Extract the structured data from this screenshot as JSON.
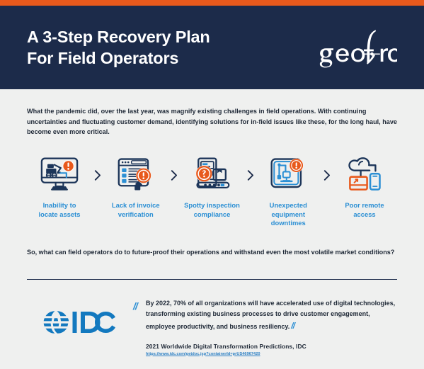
{
  "colors": {
    "accent_orange": "#e8591c",
    "navy": "#1c2b4a",
    "link_blue": "#2b8fd4",
    "page_background": "#eff0ef"
  },
  "header": {
    "title_line_1": "A 3-Step Recovery Plan",
    "title_line_2": "For Field Operators",
    "logo_name": "geoforce",
    "logo_text_part_1": "geo",
    "logo_text_part_2": "f",
    "logo_text_part_3": "orce"
  },
  "intro": {
    "paragraph": "What the pandemic did, over the last year, was magnify existing challenges in field operations. With continuing uncertainties and fluctuating customer demand, identifying solutions for in-field issues like these, for the long haul, have become even more critical."
  },
  "challenges": {
    "separator_icon": "chevron-right-icon",
    "items": [
      {
        "icon": "monitor-excavator-alert-icon",
        "label": "Inability to\nlocate assets"
      },
      {
        "icon": "invoice-magnifier-alert-icon",
        "label": "Lack of invoice\nverification"
      },
      {
        "icon": "inspection-question-icon",
        "label": "Spotty inspection\ncompliance"
      },
      {
        "icon": "equipment-downtime-alert-icon",
        "label": "Unexpected equipment\ndowntimes"
      },
      {
        "icon": "cloud-remote-access-icon",
        "label": "Poor remote\naccess"
      }
    ]
  },
  "midsection": {
    "paragraph": "So, what can field operators do to future-proof their operations and withstand even the most volatile market conditions?"
  },
  "quote": {
    "logo_name": "idc-logo",
    "logo_text": "IDC",
    "open_quote_mark": "//",
    "close_quote_mark": "//",
    "text": "By 2022, 70% of all organizations will have accelerated use of digital technologies, transforming existing business processes to drive customer engagement, employee productivity, and business resiliency.",
    "source": "2021 Worldwide Digital Transformation Predictions, IDC",
    "url": "https://www.idc.com/getdoc.jsp?containerId=prUS46967420"
  }
}
